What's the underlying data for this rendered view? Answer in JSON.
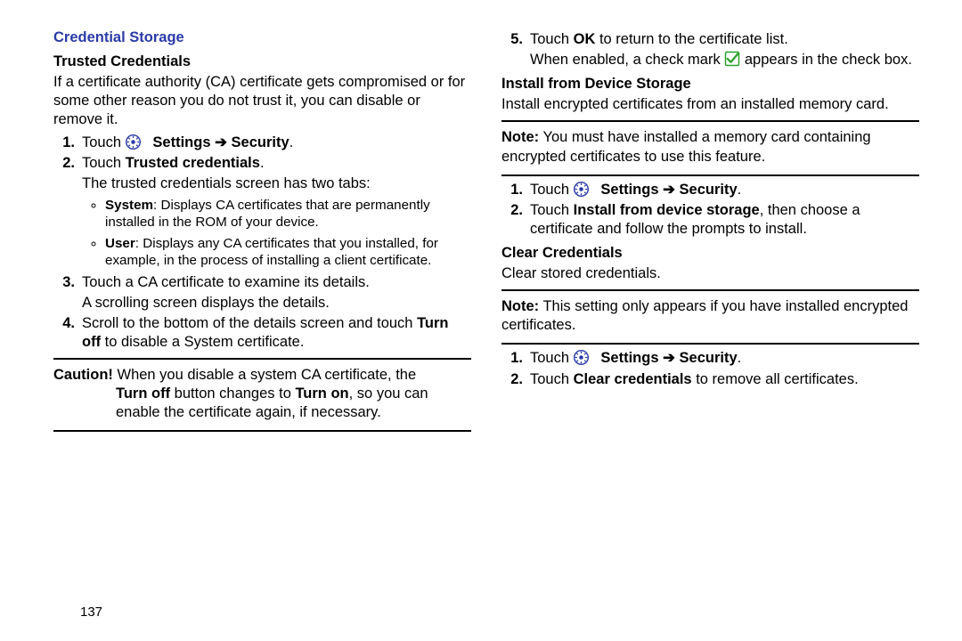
{
  "page_number": "137",
  "left": {
    "section_title": "Credential Storage",
    "trusted_title": "Trusted Credentials",
    "trusted_intro": "If a certificate authority (CA) certificate gets compromised or for some other reason you do not trust it, you can disable or remove it.",
    "s1_touch": "Touch ",
    "s1_settings": "Settings",
    "s1_security": "Security",
    "s2_touch": "Touch ",
    "s2_bold": "Trusted credentials",
    "s2_tabs_line": "The trusted credentials screen has two tabs:",
    "b1_label": "System",
    "b1_rest": ": Displays CA certificates that are permanently installed in the ROM of your device.",
    "b2_label": "User",
    "b2_rest": ": Displays any CA certificates that you installed, for example, in the process of installing a client certificate.",
    "s3_a": "Touch a CA certificate to examine its details.",
    "s3_b": "A scrolling screen displays the details.",
    "s4_a": "Scroll to the bottom of the details screen and touch ",
    "s4_bold": "Turn off",
    "s4_b": " to disable a System certificate.",
    "caution_label": "Caution!",
    "caution_rest_a": " When you disable a system CA certificate, the ",
    "caution_bold1": "Turn off",
    "caution_mid": " button changes to ",
    "caution_bold2": "Turn on",
    "caution_rest_b": ", so you can enable the certificate again, if necessary."
  },
  "right": {
    "s5_a": "Touch ",
    "s5_bold": "OK",
    "s5_b": " to return to the certificate list.",
    "s5_line2a": "When enabled, a check mark ",
    "s5_line2b": " appears in the check box.",
    "install_title": "Install from Device Storage",
    "install_intro": "Install encrypted certificates from an installed memory card.",
    "note1_label": "Note:",
    "note1_text": " You must have installed a memory card containing encrypted certificates to use this feature.",
    "i1_touch": "Touch ",
    "i1_settings": "Settings",
    "i1_security": "Security",
    "i2_a": "Touch ",
    "i2_bold": "Install from device storage",
    "i2_b": ", then choose a certificate and follow the prompts to install.",
    "clear_title": "Clear Credentials",
    "clear_intro": "Clear stored credentials.",
    "note2_label": "Note:",
    "note2_text": " This setting only appears if you have installed encrypted certificates.",
    "c1_touch": "Touch ",
    "c1_settings": "Settings",
    "c1_security": "Security",
    "c2_a": "Touch ",
    "c2_bold": "Clear credentials",
    "c2_b": " to remove all certificates."
  }
}
